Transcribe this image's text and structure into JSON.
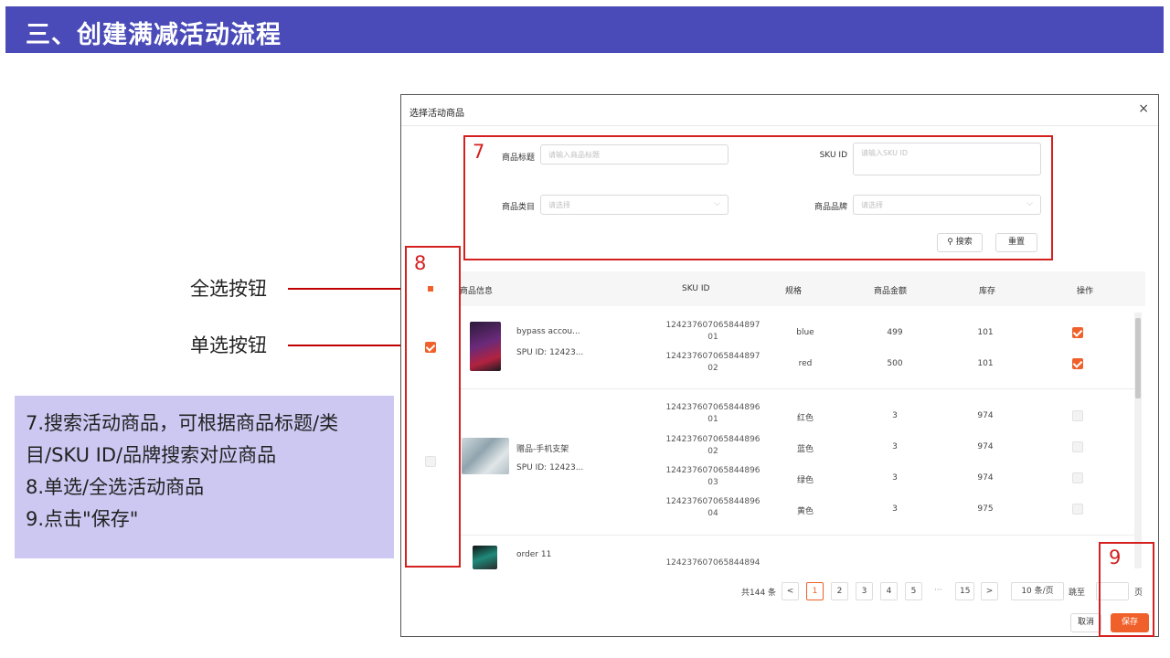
{
  "banner": {
    "title": "三、创建满减活动流程"
  },
  "annotations": {
    "select_all": "全选按钮",
    "single_select": "单选按钮",
    "num7": "7",
    "num8": "8",
    "num9": "9"
  },
  "notes": [
    "7.搜索活动商品，可根据商品标题/类",
    "目/SKU ID/品牌搜索对应商品",
    "8.单选/全选活动商品",
    "9.点击\"保存\""
  ],
  "dialog": {
    "title": "选择活动商品",
    "close": "×",
    "form": {
      "title_label": "商品标题",
      "title_placeholder": "请输入商品标题",
      "sku_label": "SKU ID",
      "sku_placeholder": "请输入SKU ID",
      "category_label": "商品类目",
      "category_placeholder": "请选择",
      "brand_label": "商品品牌",
      "brand_placeholder": "请选择",
      "search_btn": "搜索",
      "reset_btn": "重置"
    },
    "columns": [
      "商品信息",
      "SKU ID",
      "规格",
      "商品金额",
      "库存",
      "操作"
    ],
    "products": [
      {
        "name": "bypass accou...",
        "spu": "SPU ID: 12423...",
        "checked": true,
        "skus": [
          {
            "id1": "124237607065844897",
            "id2": "01",
            "spec": "blue",
            "price": "499",
            "stock": "101",
            "checked": true
          },
          {
            "id1": "124237607065844897",
            "id2": "02",
            "spec": "red",
            "price": "500",
            "stock": "101",
            "checked": true
          }
        ]
      },
      {
        "name": "赠品-手机支架",
        "spu": "SPU ID: 12423...",
        "checked": false,
        "skus": [
          {
            "id1": "124237607065844896",
            "id2": "01",
            "spec": "红色",
            "price": "3",
            "stock": "974",
            "checked": false
          },
          {
            "id1": "124237607065844896",
            "id2": "02",
            "spec": "蓝色",
            "price": "3",
            "stock": "974",
            "checked": false
          },
          {
            "id1": "124237607065844896",
            "id2": "03",
            "spec": "绿色",
            "price": "3",
            "stock": "974",
            "checked": false
          },
          {
            "id1": "124237607065844896",
            "id2": "04",
            "spec": "黄色",
            "price": "3",
            "stock": "975",
            "checked": false
          }
        ]
      },
      {
        "name": "order 11",
        "sku_partial": "124237607065844894"
      }
    ],
    "pagination": {
      "total": "共144 条",
      "prev": "<",
      "pages": [
        "1",
        "2",
        "3",
        "4",
        "5"
      ],
      "ellipsis": "···",
      "last": "15",
      "next": ">",
      "page_size": "10 条/页",
      "jump_label": "跳至",
      "page_unit": "页"
    },
    "footer": {
      "cancel": "取消",
      "save": "保存"
    }
  },
  "colors": {
    "banner": "#4a4bb8",
    "accent": "#f0602a",
    "annotation": "#d42020",
    "notes_bg": "#cdc8f2"
  }
}
